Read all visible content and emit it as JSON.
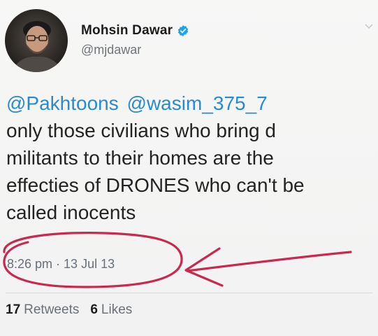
{
  "tweet": {
    "author": {
      "display_name": "Mohsin Dawar",
      "handle": "@mjdawar",
      "verified_icon": "verified-badge-icon",
      "verified_color": "#1da1f2"
    },
    "mentions": [
      "@Pakhtoons",
      "@wasim_375_7"
    ],
    "body_lines": [
      "only those civilians who bring d",
      "militants to their homes are the",
      "effecties of DRONES who can't be",
      "called inocents"
    ],
    "time": "8:26 pm",
    "separator": "·",
    "date": "13 Jul 13",
    "stats": {
      "retweets_count": "17",
      "retweets_label": "Retweets",
      "likes_count": "6",
      "likes_label": "Likes"
    }
  },
  "annotation": {
    "type": "hand-drawn circle and arrow",
    "color": "#c8294e"
  },
  "colors": {
    "mention": "#2a8ad1",
    "text": "#232323",
    "meta": "#68707a"
  }
}
